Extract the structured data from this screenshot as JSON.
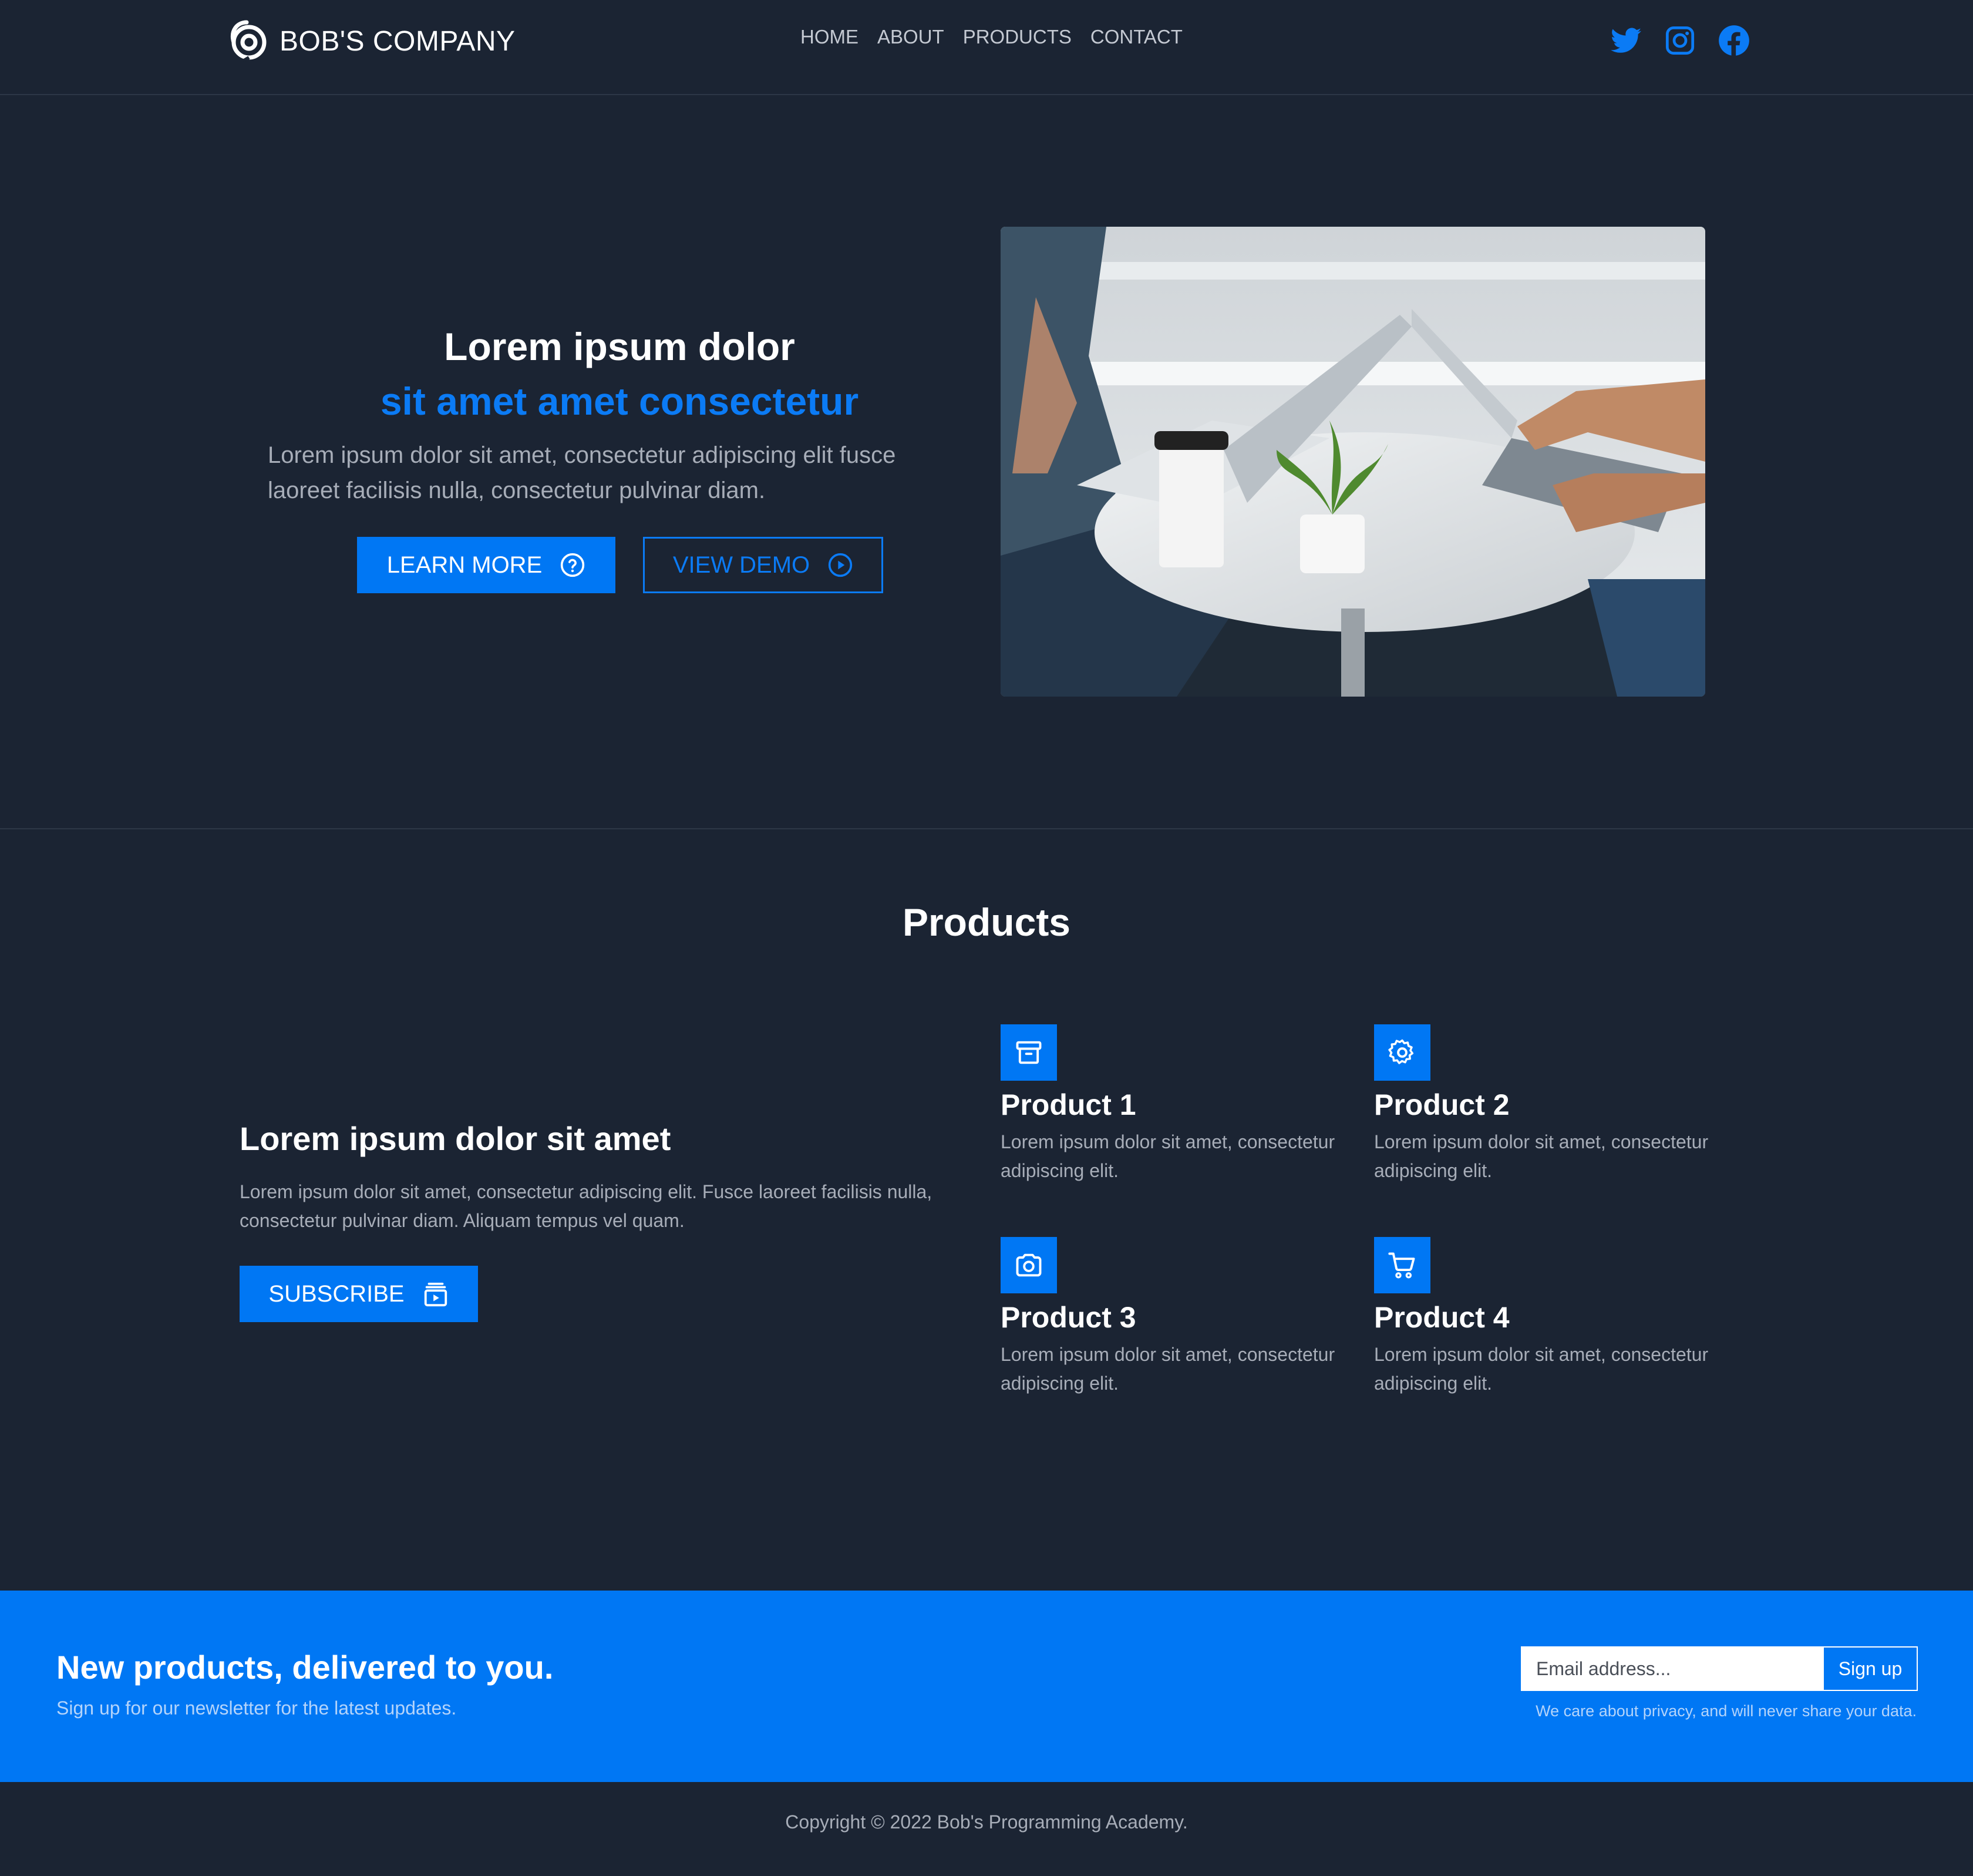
{
  "header": {
    "brand": "BOB'S COMPANY",
    "nav": [
      "HOME",
      "ABOUT",
      "PRODUCTS",
      "CONTACT"
    ],
    "social_icons": [
      "twitter-icon",
      "instagram-icon",
      "facebook-icon"
    ]
  },
  "hero": {
    "title": "Lorem ipsum dolor",
    "subtitle": "sit amet amet consectetur",
    "body": "Lorem ipsum dolor sit amet, consectetur adipiscing elit fusce laoreet facilisis nulla, consectetur pulvinar diam.",
    "learn_more": "LEARN MORE",
    "view_demo": "VIEW DEMO"
  },
  "products": {
    "title": "Products",
    "feature_heading": "Lorem ipsum dolor sit amet",
    "feature_body": "Lorem ipsum dolor sit amet, consectetur adipiscing elit. Fusce laoreet facilisis nulla, consectetur pulvinar diam. Aliquam tempus vel quam.",
    "subscribe": "SUBSCRIBE",
    "items": [
      {
        "name": "Product 1",
        "desc": "Lorem ipsum dolor sit amet, consectetur adipiscing elit.",
        "icon": "archive-icon"
      },
      {
        "name": "Product 2",
        "desc": "Lorem ipsum dolor sit amet, consectetur adipiscing elit.",
        "icon": "gear-icon"
      },
      {
        "name": "Product 3",
        "desc": "Lorem ipsum dolor sit amet, consectetur adipiscing elit.",
        "icon": "camera-icon"
      },
      {
        "name": "Product 4",
        "desc": "Lorem ipsum dolor sit amet, consectetur adipiscing elit.",
        "icon": "cart-icon"
      }
    ]
  },
  "newsletter": {
    "heading": "New products, delivered to you.",
    "subtext": "Sign up for our newsletter for the latest updates.",
    "email_placeholder": "Email address...",
    "signup": "Sign up",
    "privacy": "We care about privacy, and will never share your data."
  },
  "footer": {
    "copyright": "Copyright © 2022 Bob's Programming Academy."
  },
  "colors": {
    "background": "#1b2433",
    "accent": "#0077f4",
    "muted_text": "#a7adb8"
  }
}
